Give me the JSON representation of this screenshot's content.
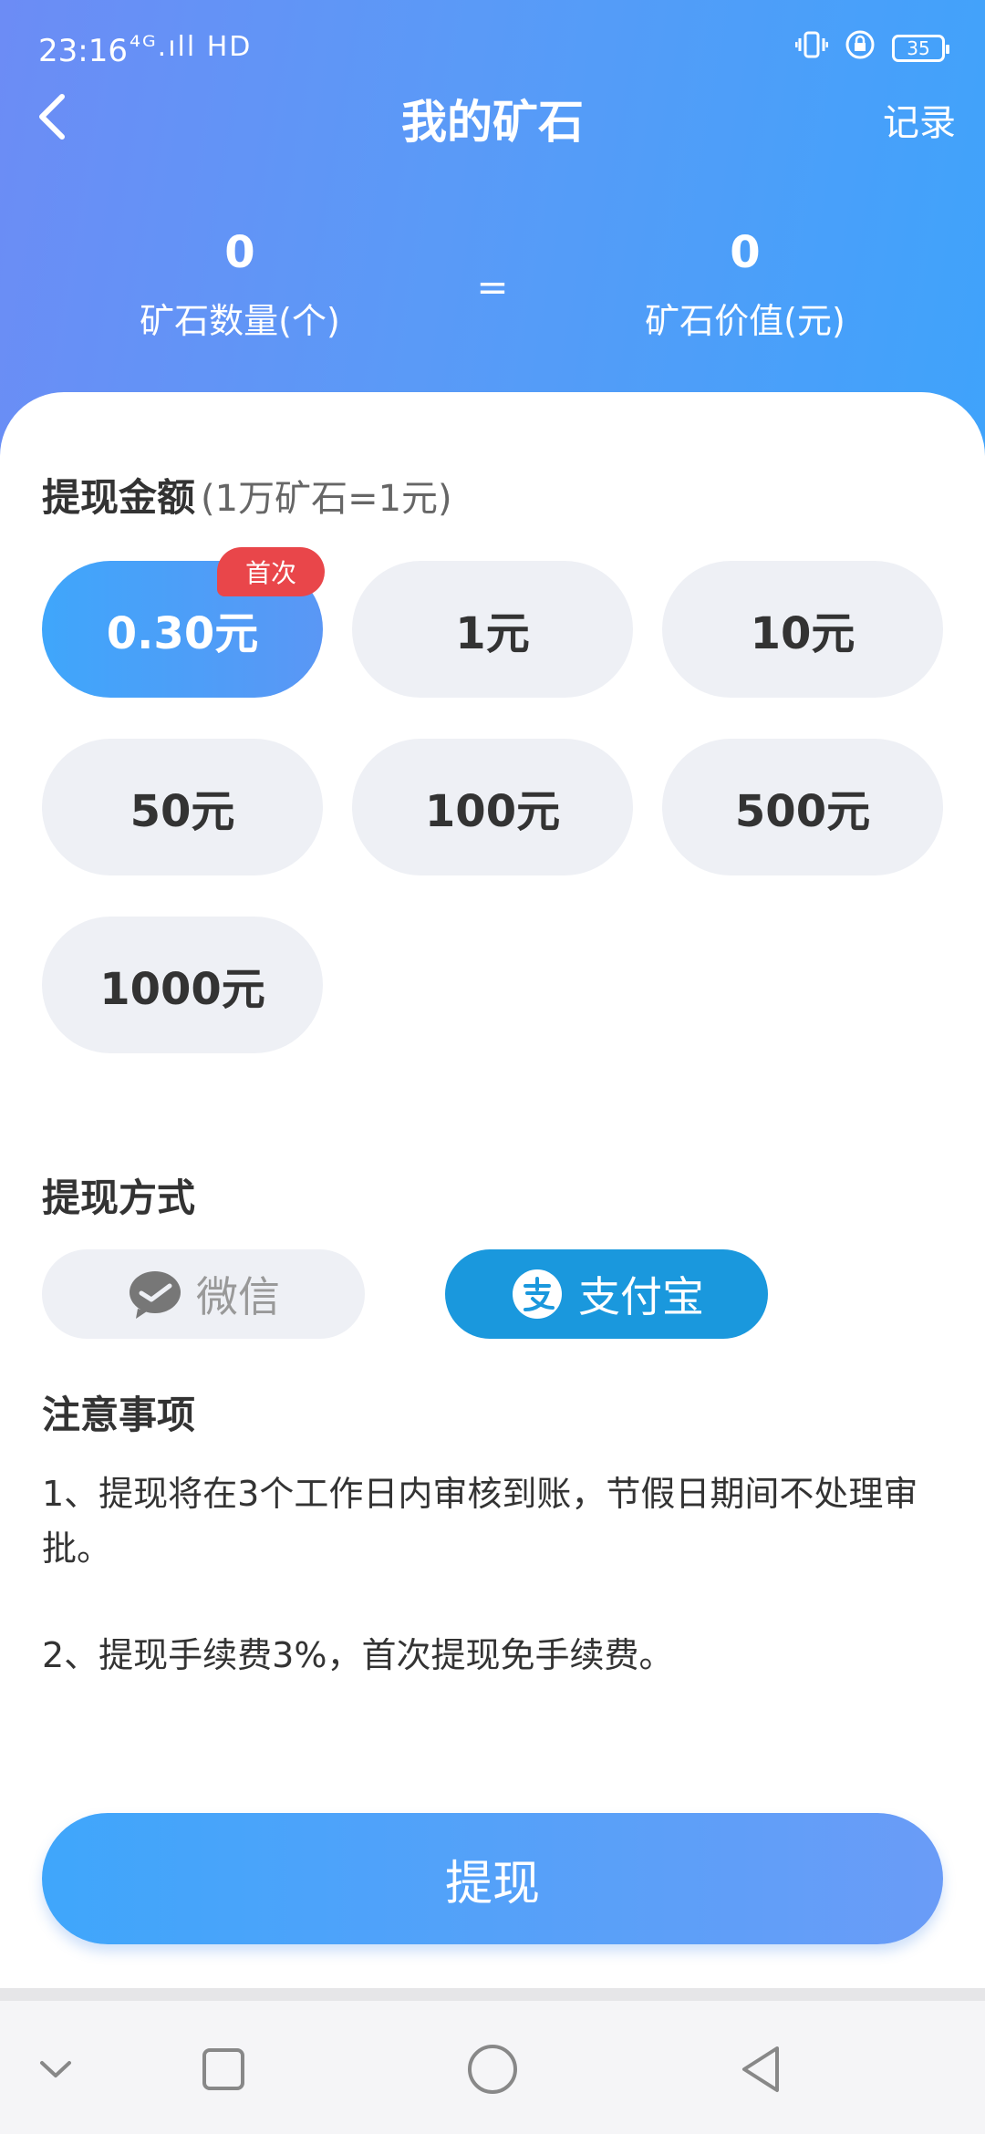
{
  "status_bar": {
    "time": "23:16",
    "network": "⁴ᴳ.ıll HD",
    "battery": "35",
    "icons": [
      "vibrate-icon",
      "lock-rotation-icon",
      "battery-icon"
    ]
  },
  "header": {
    "title": "我的矿石",
    "record_label": "记录",
    "back_icon": "back-arrow-icon"
  },
  "stats": {
    "ore_count": "0",
    "ore_count_label": "矿石数量(个)",
    "equals": "=",
    "ore_value": "0",
    "ore_value_label": "矿石价值(元)"
  },
  "withdraw": {
    "title": "提现金额",
    "subtitle": "(1万矿石=1元)",
    "badge": "首次",
    "amounts": [
      "0.30元",
      "1元",
      "10元",
      "50元",
      "100元",
      "500元",
      "1000元"
    ],
    "selected_index": 0
  },
  "method": {
    "title": "提现方式",
    "wechat": "微信",
    "alipay": "支付宝",
    "selected": "alipay"
  },
  "notice": {
    "title": "注意事项",
    "items": [
      "1、提现将在3个工作日内审核到账，节假日期间不处理审批。",
      "2、提现手续费3%，首次提现免手续费。"
    ]
  },
  "submit_label": "提现",
  "colors": {
    "header_gradient_start": "#6c8cf5",
    "header_gradient_end": "#3fa3fb",
    "badge": "#e9464a",
    "alipay": "#1a98dd",
    "chip_bg": "#eef0f5"
  },
  "nav": [
    "nav-down-icon",
    "nav-recents-icon",
    "nav-home-icon",
    "nav-back-icon"
  ]
}
